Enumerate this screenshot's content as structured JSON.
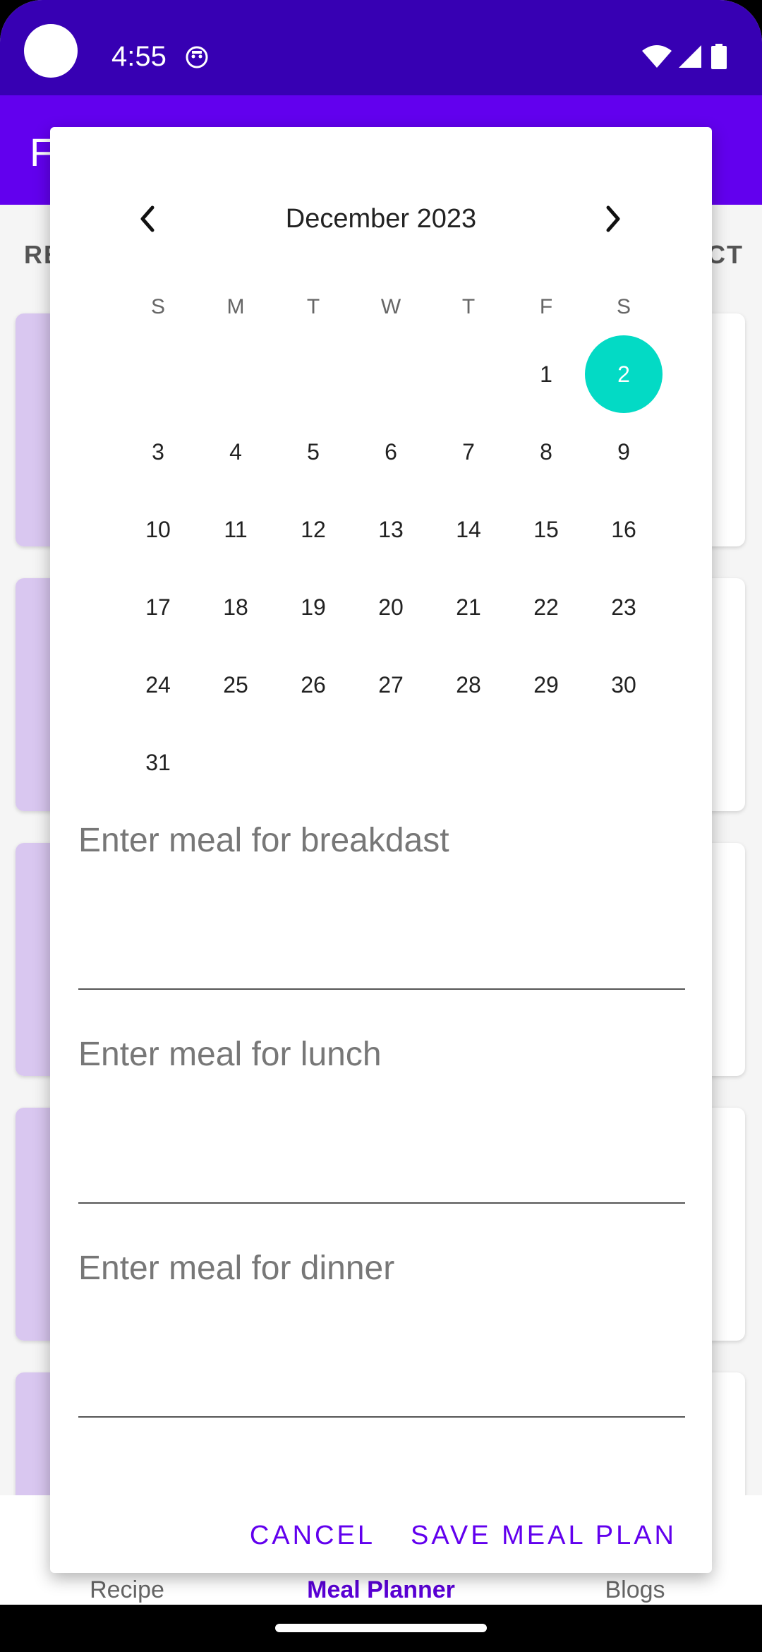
{
  "status_bar": {
    "time": "4:55"
  },
  "app_bar": {
    "title": "F"
  },
  "background_tabs": {
    "left": "RE",
    "right": "CT"
  },
  "bottom_nav": {
    "items": [
      {
        "label": "Recipe",
        "active": false
      },
      {
        "label": "Meal Planner",
        "active": true
      },
      {
        "label": "Blogs",
        "active": false
      }
    ]
  },
  "calendar": {
    "month_title": "December 2023",
    "prev_icon": "chevron-left-icon",
    "next_icon": "chevron-right-icon",
    "weekdays": [
      "S",
      "M",
      "T",
      "W",
      "T",
      "F",
      "S"
    ],
    "weeks": [
      [
        "",
        "",
        "",
        "",
        "",
        "1",
        "2"
      ],
      [
        "3",
        "4",
        "5",
        "6",
        "7",
        "8",
        "9"
      ],
      [
        "10",
        "11",
        "12",
        "13",
        "14",
        "15",
        "16"
      ],
      [
        "17",
        "18",
        "19",
        "20",
        "21",
        "22",
        "23"
      ],
      [
        "24",
        "25",
        "26",
        "27",
        "28",
        "29",
        "30"
      ],
      [
        "31",
        "",
        "",
        "",
        "",
        "",
        ""
      ]
    ],
    "selected_day": "2",
    "selection_color": "#03dac5"
  },
  "meal_fields": {
    "breakfast": {
      "placeholder": "Enter meal for breakdast",
      "value": ""
    },
    "lunch": {
      "placeholder": "Enter meal for lunch",
      "value": ""
    },
    "dinner": {
      "placeholder": "Enter meal for dinner",
      "value": ""
    }
  },
  "actions": {
    "cancel_label": "CANCEL",
    "save_label": "SAVE MEAL PLAN"
  },
  "colors": {
    "status_bar": "#3700b3",
    "primary": "#6200ee",
    "accent": "#03dac5"
  }
}
